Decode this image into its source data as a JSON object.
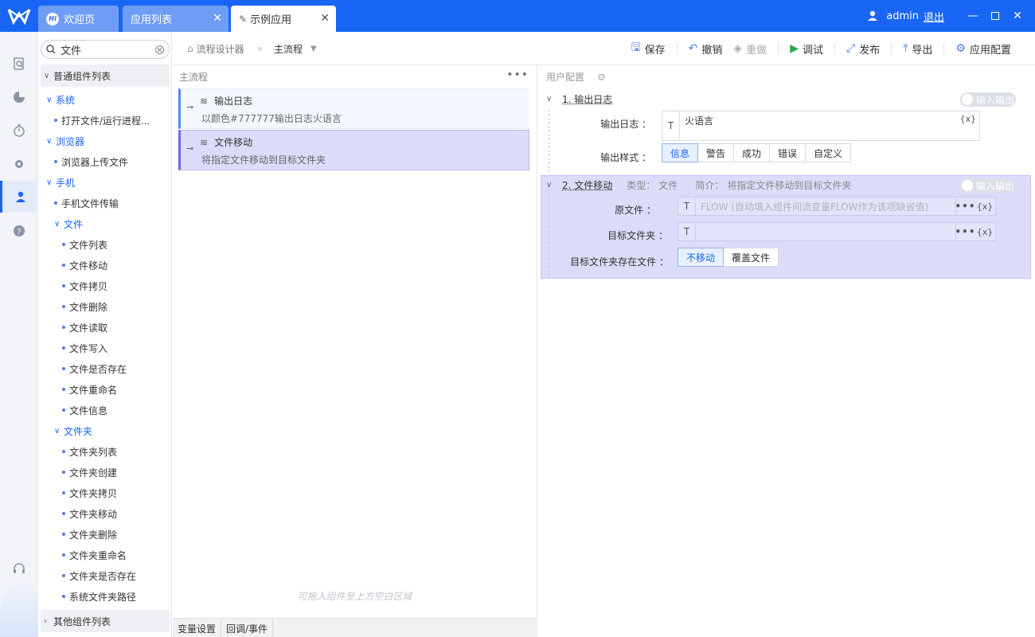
{
  "tabs": [
    {
      "label": "欢迎页",
      "badge": "Hi",
      "active": false,
      "closable": false
    },
    {
      "label": "应用列表",
      "active": false,
      "closable": true
    },
    {
      "label": "示例应用",
      "active": true,
      "closable": true
    }
  ],
  "user": {
    "name": "admin",
    "logout": "退出"
  },
  "rail": [
    "search-doc-icon",
    "pie-chart-icon",
    "timer-icon",
    "gear-icon",
    "user-icon",
    "help-icon",
    "headset-icon"
  ],
  "tree": {
    "search_value": "文件",
    "group1": "普通组件列表",
    "group2": "其他组件列表",
    "nodes": [
      {
        "label": "系统",
        "type": "cat"
      },
      {
        "label": "打开文件/运行进程...",
        "type": "leaf"
      },
      {
        "label": "浏览器",
        "type": "cat"
      },
      {
        "label": "浏览器上传文件",
        "type": "leaf"
      },
      {
        "label": "手机",
        "type": "cat"
      },
      {
        "label": "手机文件传输",
        "type": "leaf"
      },
      {
        "label": "文件",
        "type": "subcat"
      },
      {
        "label": "文件列表",
        "type": "leaf2"
      },
      {
        "label": "文件移动",
        "type": "leaf2"
      },
      {
        "label": "文件拷贝",
        "type": "leaf2"
      },
      {
        "label": "文件删除",
        "type": "leaf2"
      },
      {
        "label": "文件读取",
        "type": "leaf2"
      },
      {
        "label": "文件写入",
        "type": "leaf2"
      },
      {
        "label": "文件是否存在",
        "type": "leaf2"
      },
      {
        "label": "文件重命名",
        "type": "leaf2"
      },
      {
        "label": "文件信息",
        "type": "leaf2"
      },
      {
        "label": "文件夹",
        "type": "subcat"
      },
      {
        "label": "文件夹列表",
        "type": "leaf2"
      },
      {
        "label": "文件夹创建",
        "type": "leaf2"
      },
      {
        "label": "文件夹拷贝",
        "type": "leaf2"
      },
      {
        "label": "文件夹移动",
        "type": "leaf2"
      },
      {
        "label": "文件夹删除",
        "type": "leaf2"
      },
      {
        "label": "文件夹重命名",
        "type": "leaf2"
      },
      {
        "label": "文件夹是否存在",
        "type": "leaf2"
      },
      {
        "label": "系统文件夹路径",
        "type": "leaf2"
      }
    ]
  },
  "breadcrumb": {
    "root": "流程设计器",
    "current": "主流程"
  },
  "toolbar": {
    "save": "保存",
    "undo": "撤销",
    "redo": "重做",
    "debug": "调试",
    "publish": "发布",
    "export": "导出",
    "app_config": "应用配置"
  },
  "flow": {
    "title": "主流程",
    "more": "•••",
    "cards": [
      {
        "name": "输出日志",
        "desc": "以颜色#777777输出日志火语言"
      },
      {
        "name": "文件移动",
        "desc": "将指定文件移动到目标文件夹"
      }
    ],
    "drop_hint": "可拖入组件至上方空白区域",
    "bottom_tabs": [
      "变量设置",
      "回调/事件"
    ]
  },
  "config": {
    "title": "用户配置",
    "io_toggle": "输入输出",
    "sec1": {
      "title": "1. 输出日志",
      "log_label": "输出日志 ：",
      "log_value": "火语言",
      "style_label": "输出样式 ：",
      "styles": [
        "信息",
        "警告",
        "成功",
        "错误",
        "自定义"
      ],
      "selected_style": "信息"
    },
    "sec2": {
      "title": "2. 文件移动",
      "type_label": "类型：",
      "type_value": "文件",
      "intro_label": "简介：",
      "intro_value": "将指定文件移动到目标文件夹",
      "src_label": "原文件 ：",
      "src_placeholder": "FLOW (自动填入组件间流变量FLOW作为该项缺省值)",
      "dst_label": "目标文件夹 ：",
      "exists_label": "目标文件夹存在文件 ：",
      "exists_options": [
        "不移动",
        "覆盖文件"
      ],
      "exists_selected": "不移动"
    },
    "var_token": "{x}",
    "t_token": "T"
  },
  "colors": {
    "brand": "#1966f5",
    "selected": "#dcdcfa"
  }
}
